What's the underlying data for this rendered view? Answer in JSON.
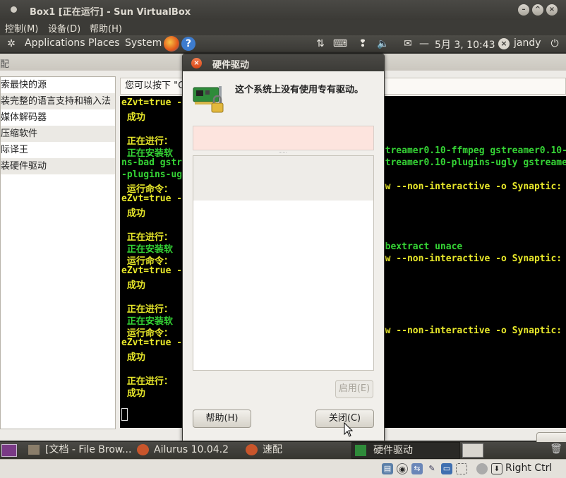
{
  "vbox": {
    "title": "Box1 [正在运行] - Sun VirtualBox",
    "menu": [
      "控制(M)",
      "设备(D)",
      "帮助(H)"
    ],
    "host_key": "Right Ctrl"
  },
  "panel": {
    "applications": "Applications",
    "places": "Places",
    "system": "System",
    "datetime": "5月 3, 10:43",
    "user": "jandy"
  },
  "bgwin": {
    "title_fragment": "配",
    "tasks": [
      "索最快的源",
      "装完整的语言支持和输入法",
      "媒体解码器",
      "压缩软件",
      "际译王",
      "装硬件驱动"
    ],
    "hint": "您可以按下 \"C",
    "terminal_lines": [
      {
        "c": "y",
        "t": "eZvt=true -"
      },
      {
        "c": "y",
        "t": " 成功"
      },
      {
        "c": "y",
        "t": ""
      },
      {
        "c": "y",
        "t": " 正在进行："
      },
      {
        "c": "g",
        "t": " 正在安装软"
      },
      {
        "c": "g",
        "t": "ns-bad gstr"
      },
      {
        "c": "g",
        "t": "-plugins-ug"
      },
      {
        "c": "y",
        "t": " 运行命令："
      },
      {
        "c": "y",
        "t": "eZvt=true -"
      },
      {
        "c": "y",
        "t": " 成功"
      },
      {
        "c": "y",
        "t": ""
      },
      {
        "c": "y",
        "t": " 正在进行："
      },
      {
        "c": "g",
        "t": " 正在安装软"
      },
      {
        "c": "y",
        "t": " 运行命令："
      },
      {
        "c": "y",
        "t": "eZvt=true -"
      },
      {
        "c": "y",
        "t": " 成功"
      },
      {
        "c": "y",
        "t": ""
      },
      {
        "c": "y",
        "t": " 正在进行："
      },
      {
        "c": "g",
        "t": " 正在安装软"
      },
      {
        "c": "y",
        "t": " 运行命令："
      },
      {
        "c": "y",
        "t": "eZvt=true -"
      },
      {
        "c": "y",
        "t": " 成功"
      },
      {
        "c": "y",
        "t": ""
      },
      {
        "c": "y",
        "t": " 正在进行："
      },
      {
        "c": "y",
        "t": " 成功"
      }
    ],
    "terminal_right": [
      {
        "row": 4,
        "c": "g",
        "t": "gstreamer0.10-ffmpeg gstreamer0.10-"
      },
      {
        "row": 5,
        "c": "g",
        "t": "gstreamer0.10-plugins-ugly gstreame"
      },
      {
        "row": 7,
        "c": "y",
        "t": "now --non-interactive -o Synaptic:"
      },
      {
        "row": 12,
        "c": "g",
        "t": "cabextract unace"
      },
      {
        "row": 13,
        "c": "y",
        "t": "now --non-interactive -o Synaptic:"
      },
      {
        "row": 19,
        "c": "y",
        "t": "now --non-interactive -o Synaptic:"
      }
    ]
  },
  "dialog": {
    "title": "硬件驱动",
    "message": "这个系统上没有使用专有驱动。",
    "enable_button": "启用(E)",
    "help_button": "帮助(H)",
    "close_button": "关闭(C)"
  },
  "taskbar": {
    "items": [
      "[文档 - File Brow...",
      "Ailurus 10.04.2",
      "速配",
      "硬件驱动"
    ]
  },
  "colors": {
    "terminal_yellow": "#e8e82a",
    "terminal_green": "#35d435",
    "info_bg": "#fde4de"
  }
}
